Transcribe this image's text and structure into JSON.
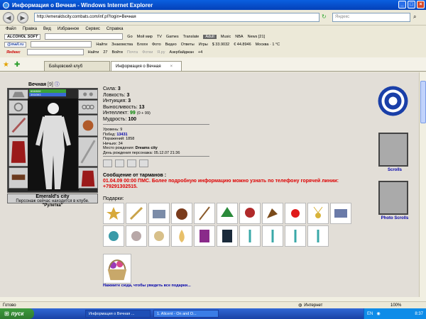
{
  "window": {
    "title": "Информация о Вечная - Windows Internet Explorer"
  },
  "address": {
    "url": "http://emeraldscity.combats.com/inf.pl?login=Вечная",
    "search_placeholder": "Яндекс"
  },
  "menu": [
    "Файл",
    "Правка",
    "Вид",
    "Избранное",
    "Сервис",
    "Справка"
  ],
  "toolbar1": {
    "logo": "ALCOHOL SOFT",
    "go": "Go",
    "items": [
      "Мой мир",
      "TV",
      "Games",
      "Translate",
      "Adult",
      "Music",
      "NBA",
      "News [21]"
    ]
  },
  "toolbar2": {
    "logo": "@mail.ru",
    "find": "Найти",
    "items": [
      "Знакомства",
      "Блоги",
      "Фото",
      "Видео",
      "Ответы",
      "Игры"
    ],
    "usd": "$ 33.9032",
    "eur": "€ 44.8946",
    "weather": "Москва · 1 °C"
  },
  "toolbar3": {
    "logo": "Яндекс",
    "find": "Найти",
    "count": "27",
    "items": [
      "Войти",
      "Почта",
      "Фотки",
      "Я.ру"
    ],
    "region": "Азербайджан",
    "temp": "+4"
  },
  "tabs": [
    {
      "label": "Бойцовский клуб"
    },
    {
      "label": "Информация о Вечная"
    }
  ],
  "character": {
    "name": "Вечная",
    "level": "[9]",
    "hp": "608/608",
    "mp": "393/393"
  },
  "stats": [
    {
      "label": "Сила:",
      "value": "3"
    },
    {
      "label": "Ловкость:",
      "value": "3"
    },
    {
      "label": "Интуиция:",
      "value": "3"
    },
    {
      "label": "Выносливость:",
      "value": "13"
    },
    {
      "label": "Интеллект:",
      "value": "99",
      "extra": "(0 + 99)"
    },
    {
      "label": "Мудрость:",
      "value": "100"
    }
  ],
  "info": {
    "level_label": "Уровень:",
    "level_value": "9",
    "wins_label": "Побед:",
    "wins_value": "13431",
    "losses_label": "Поражений:",
    "losses_value": "1858",
    "draws_label": "Ничьих:",
    "draws_value": "34",
    "birthplace_label": "Место рождения:",
    "birthplace_value": "Dreams city",
    "birthday_label": "День рождения персонажа:",
    "birthday_value": "05.12.07 21:36"
  },
  "location": {
    "city": "Emerald's city",
    "text": "Персонаж сейчас находится в клубе.",
    "room": "\"Рулетка\""
  },
  "message": {
    "header": "Сообщение от тарманов :",
    "text": "01.04.09 00:00 ПМС. Более подробную информацию можно узнать по телефону горячей линии: +79291302515."
  },
  "gifts_label": "Подарки:",
  "gifts_link": "Нажмите сюда, чтобы увидеть все подарки...",
  "sidebar": {
    "scrolls": "Scrolls",
    "photo_scrolls": "Photo Scrolls"
  },
  "status": {
    "left": "Готово",
    "zone": "Интернет",
    "zoom": "100%"
  },
  "taskbar": {
    "start": "пуск",
    "tasks": [
      "Информация о Вечная ...",
      "1. Alicent - On and O..."
    ],
    "lang": "EN",
    "clock": "8:37"
  },
  "colors": {
    "accent": "#0a5fe0",
    "red": "#dd0000",
    "green": "#008000",
    "link": "#0000aa"
  }
}
